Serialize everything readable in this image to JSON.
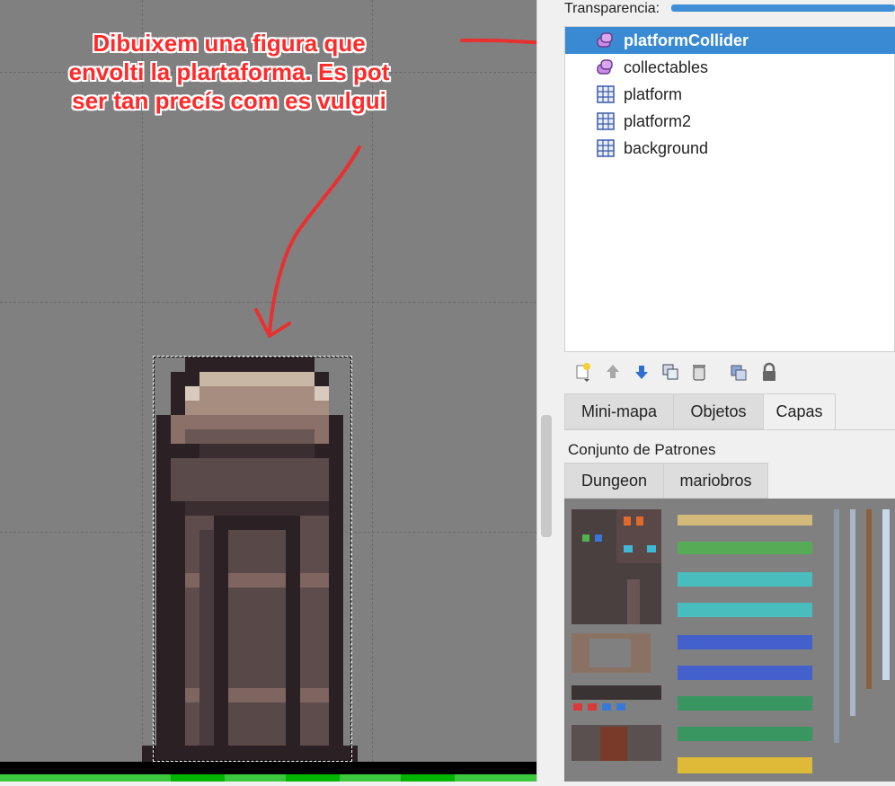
{
  "annotation": {
    "line1": "Dibuixem una figura que",
    "line2": "envolti la plartaforma. Es pot",
    "line3": "ser tan precís com es vulgui",
    "color": "#ff2a2a"
  },
  "layers_panel": {
    "transparency_label": "Transparencia:",
    "layers": [
      {
        "label": "platformCollider",
        "icon": "object-layer-icon",
        "selected": true
      },
      {
        "label": "collectables",
        "icon": "object-layer-icon",
        "selected": false
      },
      {
        "label": "platform",
        "icon": "tile-layer-icon",
        "selected": false
      },
      {
        "label": "platform2",
        "icon": "tile-layer-icon",
        "selected": false
      },
      {
        "label": "background",
        "icon": "tile-layer-icon",
        "selected": false
      }
    ],
    "toolbar_icons": [
      "new-layer-icon",
      "raise-layer-icon",
      "lower-layer-icon",
      "duplicate-layer-icon",
      "delete-layer-icon",
      "toggle-other-layers-icon",
      "lock-icon"
    ]
  },
  "dock_tabs": {
    "tabs": [
      "Mini-mapa",
      "Objetos",
      "Capas"
    ],
    "active": "Capas"
  },
  "tilesets": {
    "title": "Conjunto de Patrones",
    "tabs": [
      "Dungeon",
      "mariobros"
    ],
    "active": "Dungeon"
  },
  "colors": {
    "selection": "#3a8ad3",
    "canvas": "#808080",
    "ground_green": "#3cc83c"
  }
}
